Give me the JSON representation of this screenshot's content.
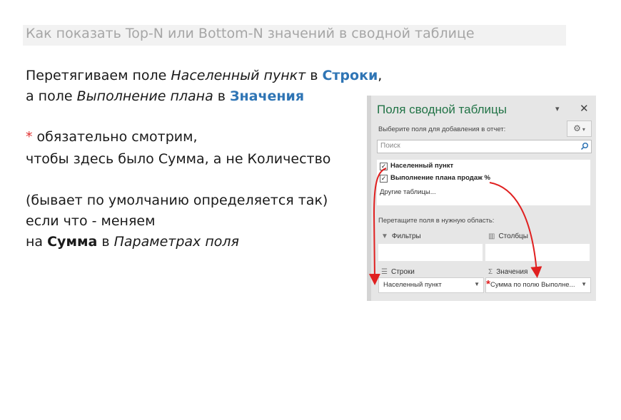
{
  "header": {
    "title": "Как показать Top-N или Bottom-N значений в сводной таблице"
  },
  "instructions": {
    "l1_pre": "Перетягиваем поле ",
    "l1_field": "Населенный пункт",
    "l1_mid": "  в ",
    "l1_target": "Строки",
    "l1_post": ",",
    "l2_pre": "а поле ",
    "l2_field": "Выполнение плана",
    "l2_mid": "  в ",
    "l2_target": "Значения",
    "note_star": "*",
    "note_l1": " обязательно смотрим,",
    "note_l2": "чтобы здесь было Сумма, а не Количество",
    "note_l3": "(бывает по умолчанию определяется так)",
    "note_l4": "если что - меняем",
    "note_l5_pre": "на ",
    "note_l5_bold": "Сумма",
    "note_l5_mid": " в ",
    "note_l5_italic": "Параметрах поля"
  },
  "pane": {
    "title": "Поля сводной таблицы",
    "choose_label": "Выберите поля для добавления в отчет:",
    "search_placeholder": "Поиск",
    "fields": [
      {
        "label": "Населенный пункт",
        "checked": true
      },
      {
        "label": "Выполнение плана продаж %",
        "checked": true
      }
    ],
    "other_tables": "Другие таблицы...",
    "drag_label": "Перетащите поля в нужную область:",
    "areas": {
      "filters": "Фильтры",
      "columns": "Столбцы",
      "rows": "Строки",
      "values": "Значения",
      "rows_item": "Населенный пункт",
      "values_item": "Сумма по полю Выполне..."
    },
    "values_star": "*"
  },
  "colors": {
    "accent_blue": "#2f75b5",
    "excel_green": "#217346",
    "arrow_red": "#e02020"
  }
}
